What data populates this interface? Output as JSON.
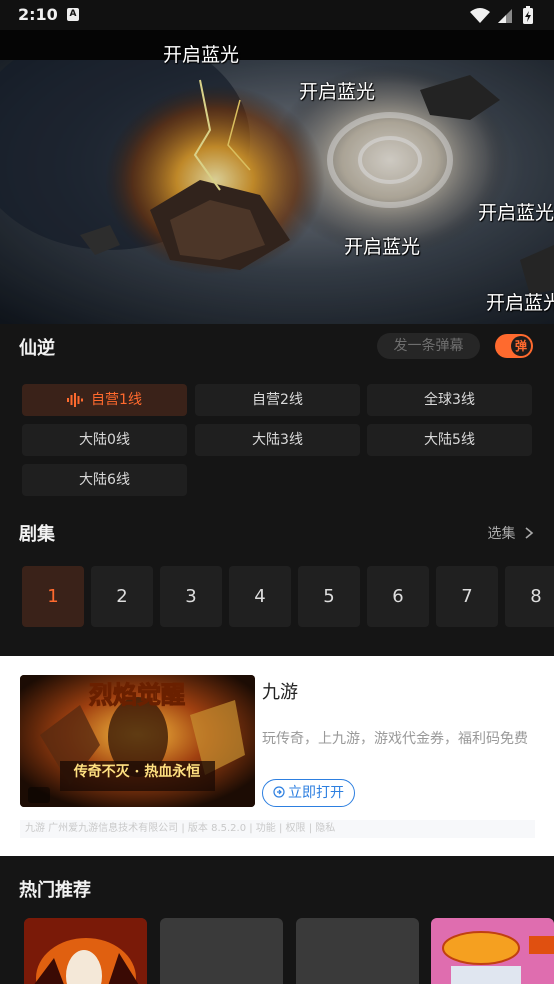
{
  "status_bar": {
    "time": "2:10",
    "badge": "A"
  },
  "player": {
    "danmaku": [
      "开启蓝光",
      "开启蓝光",
      "开启蓝光",
      "开启蓝光",
      "开启蓝光"
    ]
  },
  "show": {
    "title": "仙逆",
    "danmaku_placeholder": "发一条弹幕",
    "danmaku_toggle_label": "弹",
    "danmaku_toggle_on": true,
    "accent_color": "#ff6a2e"
  },
  "lines": [
    {
      "label": "自营1线",
      "active": true
    },
    {
      "label": "自营2线",
      "active": false
    },
    {
      "label": "全球3线",
      "active": false
    },
    {
      "label": "大陆0线",
      "active": false
    },
    {
      "label": "大陆3线",
      "active": false
    },
    {
      "label": "大陆5线",
      "active": false
    },
    {
      "label": "大陆6线",
      "active": false
    }
  ],
  "episodes": {
    "title": "剧集",
    "select_label": "选集",
    "items": [
      "1",
      "2",
      "3",
      "4",
      "5",
      "6",
      "7",
      "8"
    ],
    "active_index": 0
  },
  "ad": {
    "image_text": "烈焰觉醒",
    "image_slogan": "传奇不灭 · 热血永恒",
    "name": "九游",
    "description": "玩传奇，上九游，游戏代金券，福利码免费",
    "open_button": "立即打开",
    "footer": "九游 广州爱九游信息技术有限公司 | 版本 8.5.2.0 | 功能 | 权限 | 隐私"
  },
  "hot": {
    "title": "热门推荐",
    "cards": [
      "poster-1",
      "poster-2",
      "poster-3",
      "poster-4"
    ]
  }
}
